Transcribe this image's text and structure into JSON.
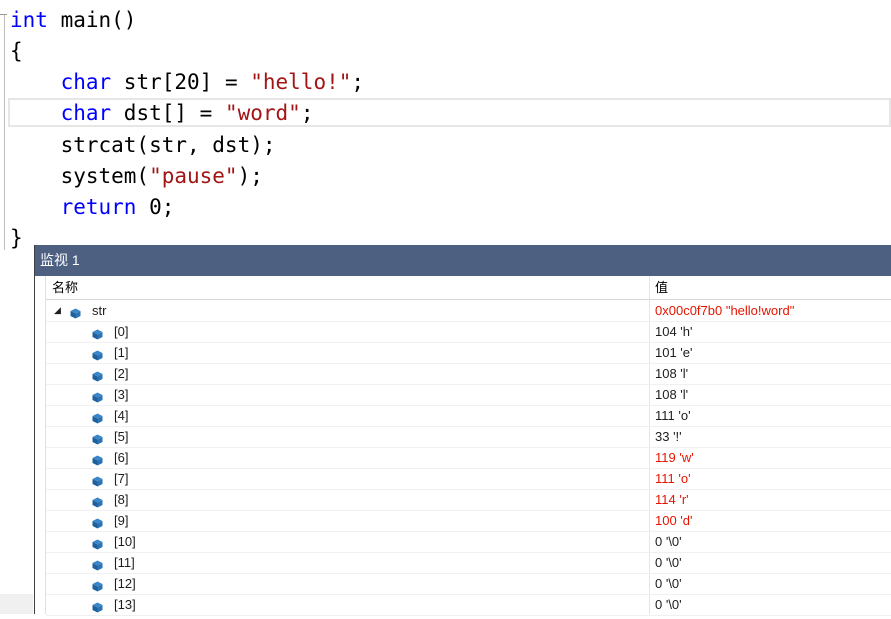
{
  "code": {
    "lines": [
      [
        {
          "t": "int",
          "c": "kw"
        },
        {
          "t": " main()",
          "c": ""
        }
      ],
      [
        {
          "t": "{",
          "c": ""
        }
      ],
      [
        {
          "t": "    ",
          "c": ""
        },
        {
          "t": "char",
          "c": "kw"
        },
        {
          "t": " str[20] = ",
          "c": ""
        },
        {
          "t": "\"hello!\"",
          "c": "str"
        },
        {
          "t": ";",
          "c": ""
        }
      ],
      [
        {
          "t": "    ",
          "c": ""
        },
        {
          "t": "char",
          "c": "kw"
        },
        {
          "t": " dst[] = ",
          "c": ""
        },
        {
          "t": "\"word\"",
          "c": "str"
        },
        {
          "t": ";",
          "c": ""
        }
      ],
      [
        {
          "t": "    strcat(str, dst);",
          "c": ""
        }
      ],
      [
        {
          "t": "    system(",
          "c": ""
        },
        {
          "t": "\"pause\"",
          "c": "str"
        },
        {
          "t": ");",
          "c": ""
        }
      ],
      [
        {
          "t": "    ",
          "c": ""
        },
        {
          "t": "return",
          "c": "kw"
        },
        {
          "t": " 0;",
          "c": ""
        }
      ],
      [
        {
          "t": "}",
          "c": ""
        }
      ]
    ]
  },
  "watch": {
    "title": "监视 1",
    "col_name": "名称",
    "col_value": "值",
    "root": {
      "name": "str",
      "value": "0x00c0f7b0 \"hello!word\"",
      "changed": true,
      "expanded_icon": "triangle-down-icon"
    },
    "items": [
      {
        "name": "[0]",
        "value": "104 'h'",
        "changed": false
      },
      {
        "name": "[1]",
        "value": "101 'e'",
        "changed": false
      },
      {
        "name": "[2]",
        "value": "108 'l'",
        "changed": false
      },
      {
        "name": "[3]",
        "value": "108 'l'",
        "changed": false
      },
      {
        "name": "[4]",
        "value": "111 'o'",
        "changed": false
      },
      {
        "name": "[5]",
        "value": "33 '!'",
        "changed": false
      },
      {
        "name": "[6]",
        "value": "119 'w'",
        "changed": true
      },
      {
        "name": "[7]",
        "value": "111 'o'",
        "changed": true
      },
      {
        "name": "[8]",
        "value": "114 'r'",
        "changed": true
      },
      {
        "name": "[9]",
        "value": "100 'd'",
        "changed": true
      },
      {
        "name": "[10]",
        "value": "0 '\\0'",
        "changed": false
      },
      {
        "name": "[11]",
        "value": "0 '\\0'",
        "changed": false
      },
      {
        "name": "[12]",
        "value": "0 '\\0'",
        "changed": false
      },
      {
        "name": "[13]",
        "value": "0 '\\0'",
        "changed": false
      }
    ]
  },
  "colors": {
    "keyword": "#0000ff",
    "string": "#a31515",
    "changed_value": "#e51400",
    "title_bar": "#4d6082"
  }
}
